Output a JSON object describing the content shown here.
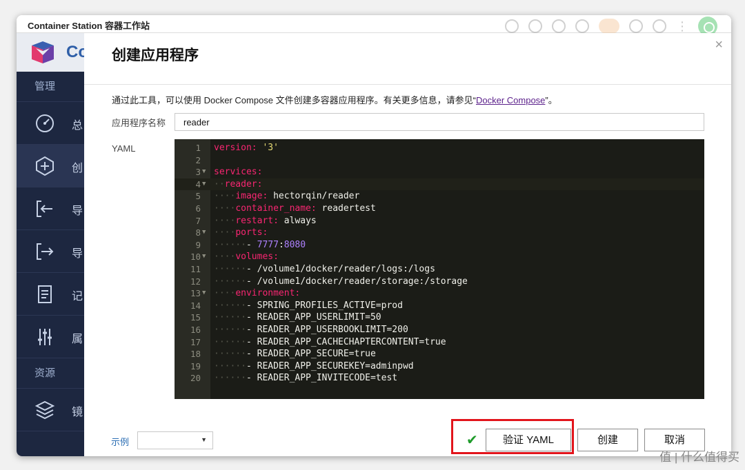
{
  "window": {
    "title": "Container Station 容器工作站"
  },
  "sidebar": {
    "logo_text": "Co",
    "sections": [
      {
        "label": "管理"
      },
      {
        "label": "资源"
      }
    ],
    "items": [
      {
        "label": "总",
        "icon": "dashboard-icon"
      },
      {
        "label": "创",
        "icon": "create-plus-icon"
      },
      {
        "label": "导",
        "icon": "import-icon"
      },
      {
        "label": "导",
        "icon": "export-icon"
      },
      {
        "label": "记",
        "icon": "log-icon"
      },
      {
        "label": "属",
        "icon": "properties-sliders-icon"
      },
      {
        "label": "镜",
        "icon": "images-layers-icon"
      }
    ]
  },
  "dialog": {
    "title": "创建应用程序",
    "close": "×",
    "description_prefix": "通过此工具，可以使用 Docker Compose 文件创建多容器应用程序。有关更多信息，请参见“",
    "description_link": "Docker Compose",
    "description_suffix": "”。",
    "app_name_label": "应用程序名称",
    "app_name_value": "reader",
    "yaml_label": "YAML",
    "example_label": "示例",
    "example_value": "",
    "buttons": {
      "verify": "验证 YAML",
      "create": "创建",
      "cancel": "取消"
    },
    "check_mark": "✔"
  },
  "yaml_lines": [
    "version: '3'",
    "",
    "services:",
    "  reader:",
    "    image: hectorqin/reader",
    "    container_name: readertest",
    "    restart: always",
    "    ports:",
    "      - 7777:8080",
    "    volumes:",
    "      - /volume1/docker/reader/logs:/logs",
    "      - /volume1/docker/reader/storage:/storage",
    "    environment:",
    "      - SPRING_PROFILES_ACTIVE=prod",
    "      - READER_APP_USERLIMIT=50",
    "      - READER_APP_USERBOOKLIMIT=200",
    "      - READER_APP_CACHECHAPTERCONTENT=true",
    "      - READER_APP_SECURE=true",
    "      - READER_APP_SECUREKEY=adminpwd",
    "      - READER_APP_INVITECODE=test"
  ],
  "watermark": "值 | 什么值得买",
  "colors": {
    "sidebar_bg": "#1d2740",
    "yaml_key": "#f92672",
    "yaml_string": "#e6db74",
    "yaml_number": "#ae81ff",
    "highlight": "#e2141b",
    "check": "#1e9b2a"
  }
}
